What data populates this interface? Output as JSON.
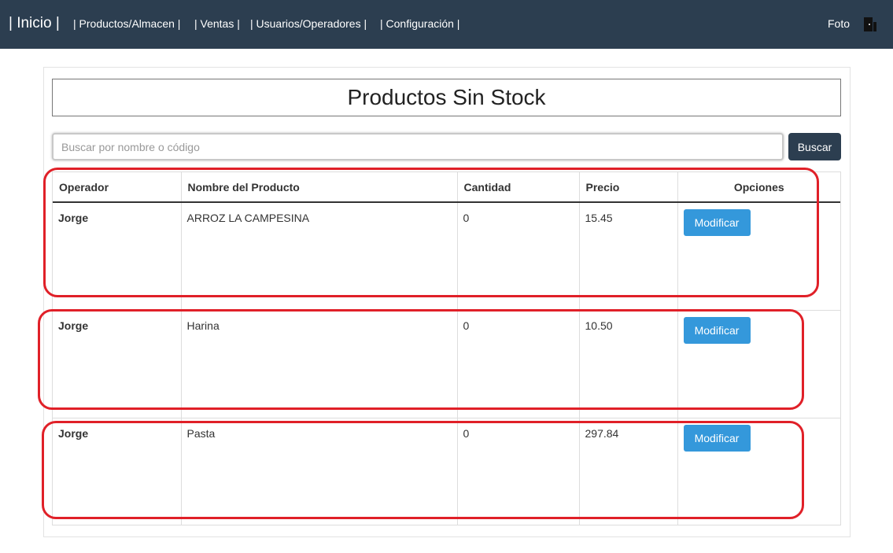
{
  "nav": {
    "brand": "| Inicio |",
    "items": [
      "| Productos/Almacen |",
      "| Ventas |",
      "| Usuarios/Operadores |",
      "| Configuración |"
    ],
    "foto": "Foto",
    "exit_icon": "door-exit-icon"
  },
  "page": {
    "title": "Productos Sin Stock"
  },
  "search": {
    "placeholder": "Buscar por nombre o código",
    "value": "",
    "button": "Buscar"
  },
  "table": {
    "headers": [
      "Operador",
      "Nombre del Producto",
      "Cantidad",
      "Precio",
      "Opciones"
    ],
    "rows": [
      {
        "operador": "Jorge",
        "nombre": "ARROZ LA CAMPESINA",
        "cantidad": "0",
        "precio": "15.45",
        "accion": "Modificar"
      },
      {
        "operador": "Jorge",
        "nombre": "Harina",
        "cantidad": "0",
        "precio": "10.50",
        "accion": "Modificar"
      },
      {
        "operador": "Jorge",
        "nombre": "Pasta",
        "cantidad": "0",
        "precio": "297.84",
        "accion": "Modificar"
      }
    ]
  },
  "colors": {
    "navbar": "#2c3e50",
    "button_primary": "#2c3e50",
    "button_modify": "#3498db",
    "highlight": "#e02028"
  }
}
